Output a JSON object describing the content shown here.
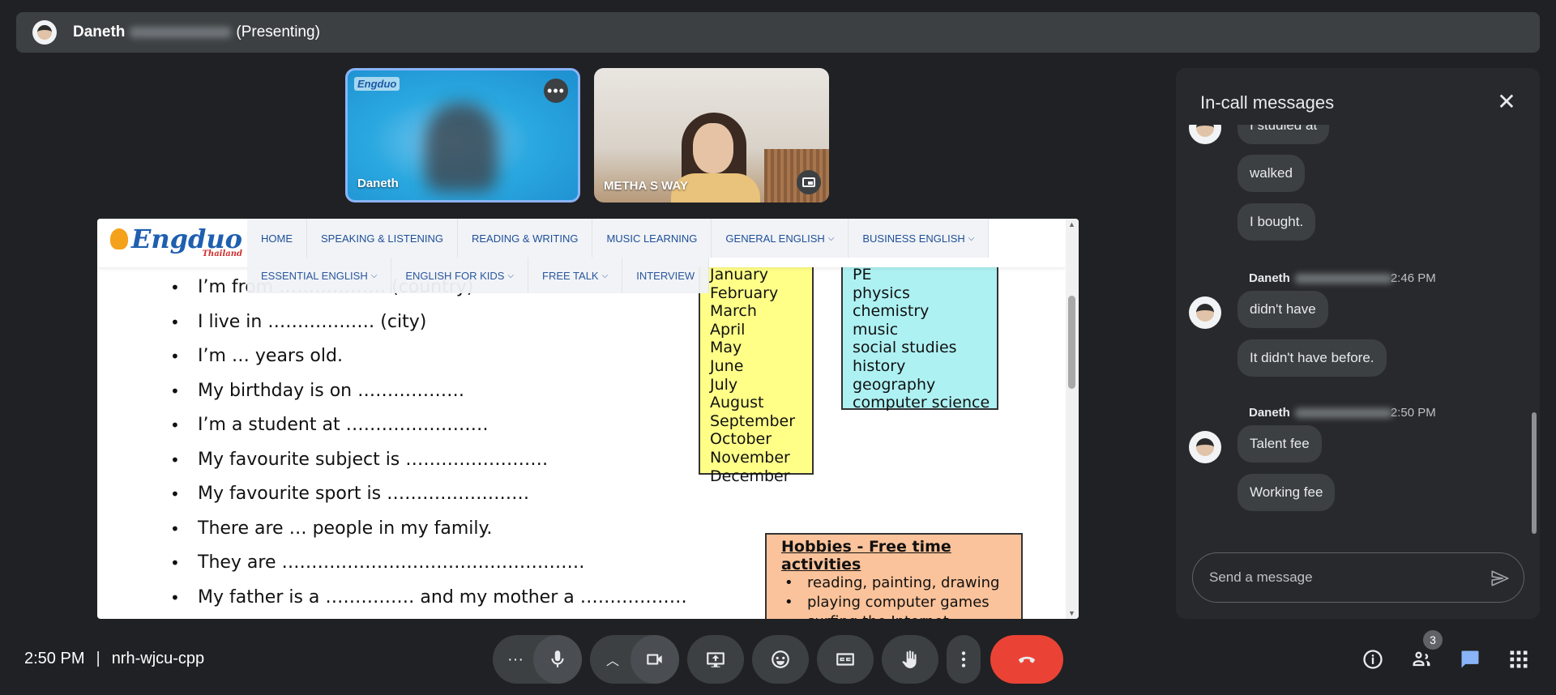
{
  "topbar": {
    "presenter_first": "Daneth",
    "presenting_label": "(Presenting)"
  },
  "tiles": [
    {
      "name": "Daneth",
      "logo": "Engduo"
    },
    {
      "name": "METHA S WAY"
    }
  ],
  "shared_site": {
    "logo": "Engduo",
    "logo_sub": "Thailand",
    "nav_row1": [
      "HOME",
      "SPEAKING & LISTENING",
      "READING & WRITING",
      "MUSIC LEARNING",
      "GENERAL ENGLISH",
      "BUSINESS ENGLISH"
    ],
    "nav_row2": [
      "ESSENTIAL ENGLISH",
      "ENGLISH FOR KIDS",
      "FREE TALK",
      "INTERVIEW"
    ],
    "worksheet_lines": [
      "I’m from ……………… (country)",
      "I live in ……………… (city)",
      "I’m  …  years old.",
      "My birthday is on ………………",
      "I’m a student at ……………………",
      "My favourite subject is ……………………",
      "My favourite sport is ……………………",
      "There are … people in my family.",
      "They are ……………………………………………",
      "My father is a …………… and my mother a ………………"
    ],
    "months": [
      "January",
      "February",
      "March",
      "April",
      "May",
      "June",
      "July",
      "August",
      "September",
      "October",
      "November",
      "December"
    ],
    "subjects": [
      "PE",
      "physics",
      "chemistry",
      "music",
      "social studies",
      "history",
      "geography",
      "computer science"
    ],
    "hobbies_title": "Hobbies - Free time activities",
    "hobbies": [
      "reading, painting, drawing",
      "playing computer games",
      "surfing the Internet"
    ]
  },
  "chat": {
    "title": "In-call messages",
    "messages_top": [
      "I studied at",
      "walked",
      "I bought."
    ],
    "group2": {
      "sender": "Daneth",
      "time": "2:46 PM",
      "messages": [
        "didn't have",
        "It didn't have before."
      ]
    },
    "group3": {
      "sender": "Daneth",
      "time": "2:50 PM",
      "messages": [
        "Talent fee",
        "Working fee"
      ]
    },
    "input_placeholder": "Send a message"
  },
  "bottom": {
    "time": "2:50 PM",
    "meeting_code": "nrh-wjcu-cpp",
    "participants_count": "3"
  }
}
